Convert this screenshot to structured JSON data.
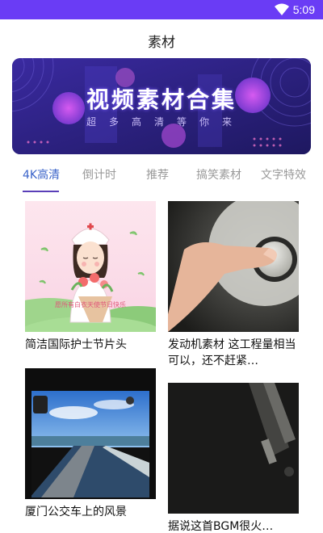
{
  "status_bar": {
    "time": "5:09",
    "color": "#6a3cf5"
  },
  "header": {
    "title": "素材"
  },
  "banner": {
    "title": "视频素材合集",
    "subtitle": "超多高清等你来"
  },
  "tabs": [
    {
      "label": "4K高清",
      "active": true
    },
    {
      "label": "倒计时",
      "active": false
    },
    {
      "label": "推荐",
      "active": false
    },
    {
      "label": "搞笑素材",
      "active": false
    },
    {
      "label": "文字特效",
      "active": false
    }
  ],
  "cards": [
    {
      "title": "简洁国际护士节片头",
      "thumb_icon": "nurse-illustration"
    },
    {
      "title": "发动机素材 这工程量相当可以，还不赶紧…",
      "thumb_icon": "engine-button-photo"
    },
    {
      "title": "厦门公交车上的风景",
      "thumb_icon": "bus-window-photo"
    },
    {
      "title": "据说这首BGM很火…",
      "thumb_icon": "dark-photo"
    }
  ],
  "thumb_text": {
    "nurse_caption": "愿所有白衣天使节日快乐"
  }
}
